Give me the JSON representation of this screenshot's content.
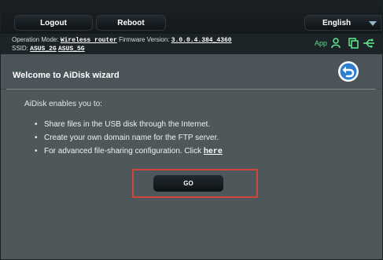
{
  "header": {
    "logout_label": "Logout",
    "reboot_label": "Reboot",
    "language": "English"
  },
  "status": {
    "operation_mode_label": "Operation Mode:",
    "operation_mode_value": "Wireless router",
    "firmware_label": "Firmware Version:",
    "firmware_value": "3.0.0.4.384_4360",
    "ssid_label": "SSID:",
    "ssid_2g": "ASUS_2G",
    "ssid_5g": "ASUS_5G",
    "app_label": "App",
    "colors": {
      "status_icon": "#5de08a"
    },
    "icons": [
      "user-icon",
      "copy-icon",
      "usb-icon"
    ]
  },
  "wizard": {
    "title": "Welcome to AiDisk wizard",
    "intro": "AiDisk enables you to:",
    "bullets": [
      "Share files in the USB disk through the Internet.",
      "Create your own domain name for the FTP server.",
      "For advanced file-sharing configuration. Click"
    ],
    "here_link": "here",
    "go_label": "GO",
    "highlight_color": "#d1453b",
    "back_icon": "back-arrow-icon"
  }
}
